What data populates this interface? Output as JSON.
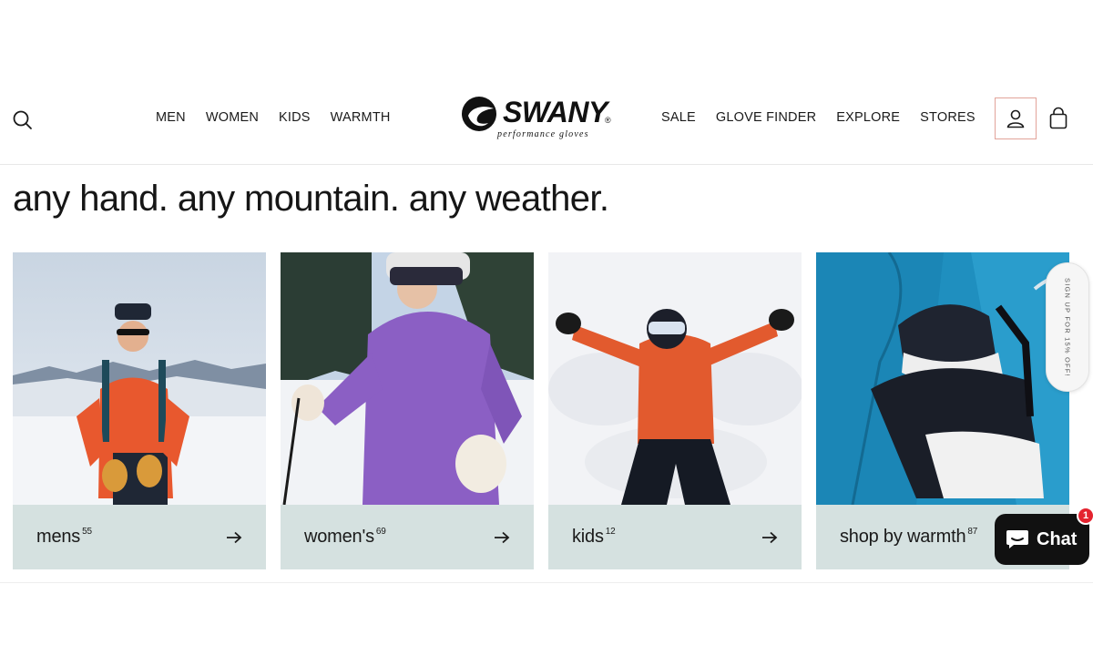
{
  "header": {
    "nav_left": [
      "MEN",
      "WOMEN",
      "KIDS",
      "WARMTH"
    ],
    "nav_right": [
      "SALE",
      "GLOVE FINDER",
      "EXPLORE",
      "STORES"
    ],
    "logo": {
      "wordmark": "SWANY",
      "registered": "®",
      "tagline": "performance gloves"
    },
    "icons": {
      "search": "search-icon",
      "account": "user-icon",
      "cart": "shopping-bag-icon"
    }
  },
  "hero": {
    "headline": "any hand. any mountain. any weather."
  },
  "categories": [
    {
      "label": "mens",
      "count": "55"
    },
    {
      "label": "women's",
      "count": "69"
    },
    {
      "label": "kids",
      "count": "12"
    },
    {
      "label": "shop by warmth",
      "count": "87"
    }
  ],
  "signup_tab": {
    "text": "SIGN UP FOR 15% OFF!"
  },
  "chat": {
    "label": "Chat",
    "badge_count": "1"
  },
  "colors": {
    "card_bar": "#d5e1e0",
    "account_border": "#e2a39a",
    "chat_bg": "#111111",
    "badge": "#e4232f"
  }
}
